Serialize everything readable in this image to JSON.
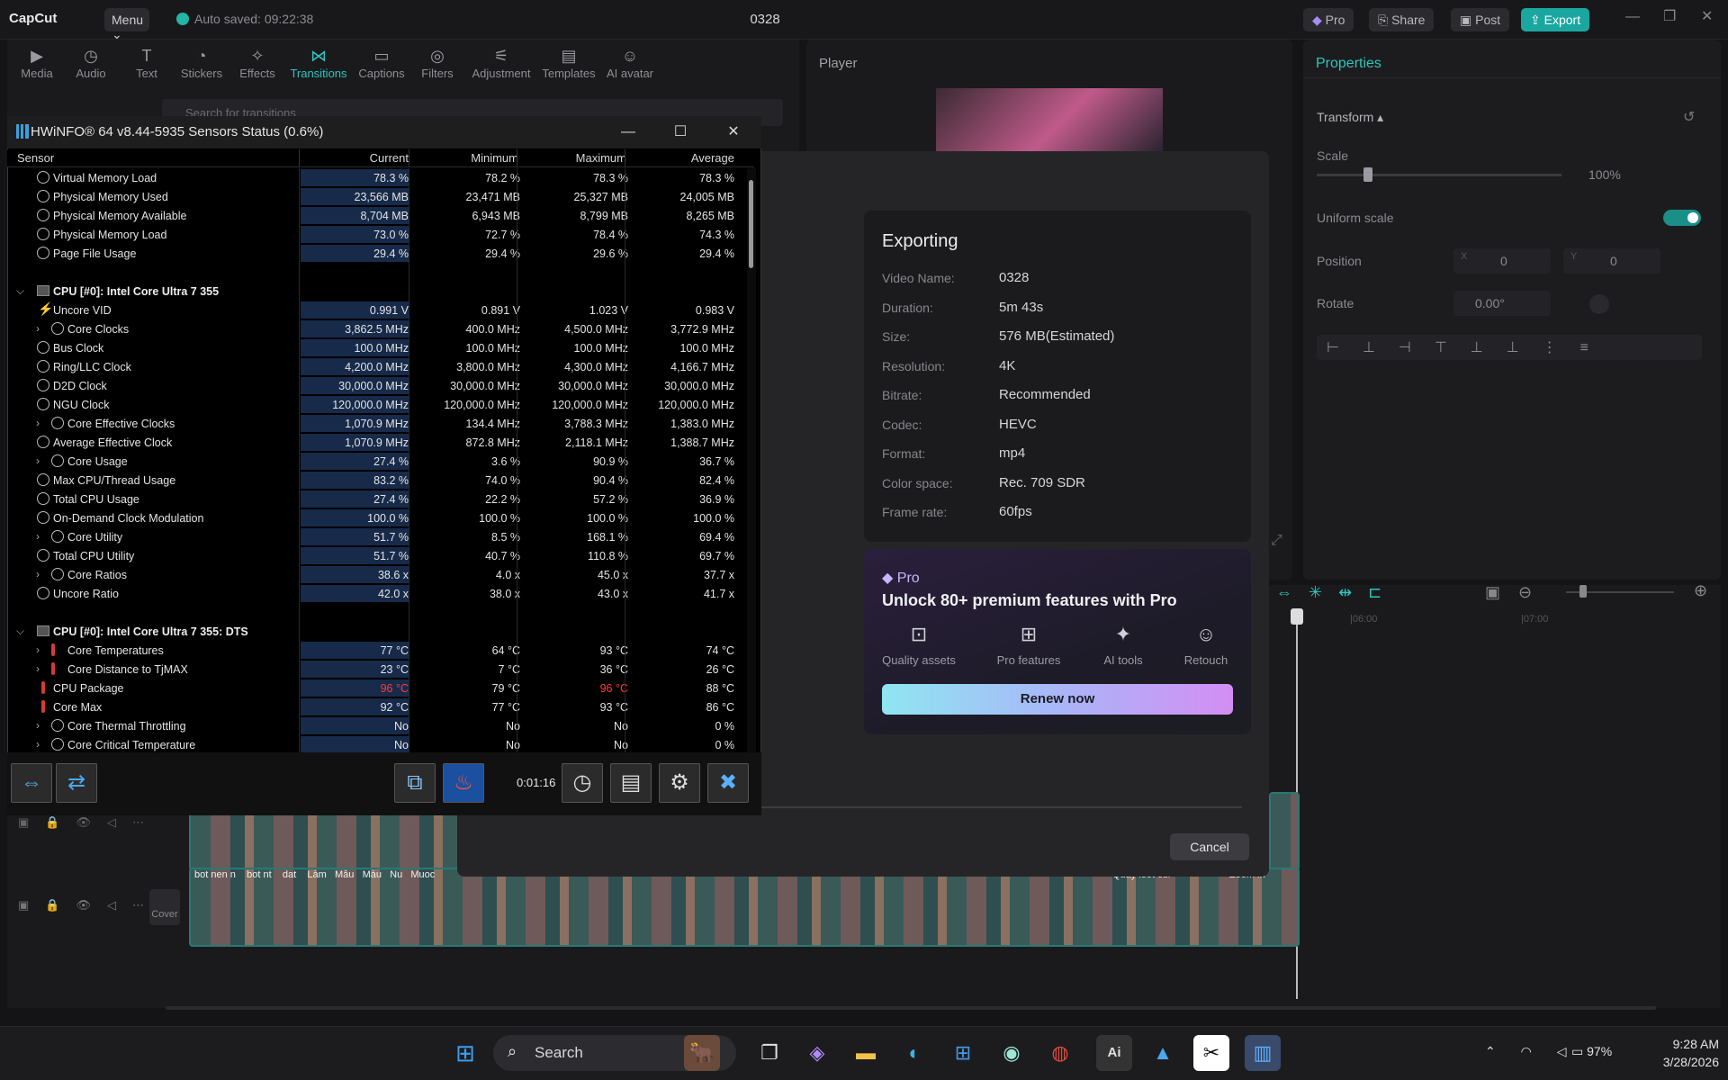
{
  "capcut": {
    "logo": "CapCut",
    "menu": "Menu ⌄",
    "autosave": "Auto saved: 09:22:38",
    "project": "0328",
    "pro_btn": "Pro",
    "share_btn": "Share",
    "post_btn": "Post",
    "export_btn": "Export",
    "tools": [
      "Media",
      "Audio",
      "Text",
      "Stickers",
      "Effects",
      "Transitions",
      "Captions",
      "Filters",
      "Adjustment",
      "Templates",
      "AI avatar"
    ],
    "active_tool": "Transitions",
    "search_placeholder": "Search for transitions",
    "player_title": "Player",
    "properties_title": "Properties",
    "transform_label": "Transform ▴",
    "scale_label": "Scale",
    "scale_value": "100%",
    "uniform_scale": "Uniform scale",
    "position_label": "Position",
    "pos_x_label": "X",
    "pos_x": "0",
    "pos_y_label": "Y",
    "pos_y": "0",
    "rotate_label": "Rotate",
    "rotate_value": "0.00°",
    "ruler_marks": [
      "|06:00",
      "|07:00"
    ],
    "track_cover": "Cover",
    "clip_captions": [
      "bot nen n",
      "bot nt",
      "dat",
      "Làm",
      "Mẫu",
      "Màu",
      "Nu",
      "Muoc",
      "Quay loot cur",
      "Zoom in"
    ]
  },
  "export": {
    "title": "Exporting",
    "fields": [
      {
        "label": "Video Name:",
        "value": "0328"
      },
      {
        "label": "Duration:",
        "value": "5m 43s"
      },
      {
        "label": "Size:",
        "value": "576 MB(Estimated)"
      },
      {
        "label": "Resolution:",
        "value": "4K"
      },
      {
        "label": "Bitrate:",
        "value": "Recommended"
      },
      {
        "label": "Codec:",
        "value": "HEVC"
      },
      {
        "label": "Format:",
        "value": "mp4"
      },
      {
        "label": "Color space:",
        "value": "Rec. 709 SDR"
      },
      {
        "label": "Frame rate:",
        "value": "60fps"
      }
    ],
    "pro_label": "Pro",
    "pro_title": "Unlock 80+ premium features with Pro",
    "features": [
      "Quality assets",
      "Pro features",
      "AI tools",
      "Retouch"
    ],
    "renew": "Renew now",
    "cancel": "Cancel"
  },
  "hwinfo": {
    "title": "HWiNFO® 64 v8.44-5935 Sensors Status (0.6%)",
    "columns": [
      "Sensor",
      "Current",
      "Minimum",
      "Maximum",
      "Average"
    ],
    "rows": [
      {
        "name": "Virtual Memory Load",
        "cur": "78.3 %",
        "min": "78.2 %",
        "max": "78.3 %",
        "avg": "78.3 %"
      },
      {
        "name": "Physical Memory Used",
        "cur": "23,566 MB",
        "min": "23,471 MB",
        "max": "25,327 MB",
        "avg": "24,005 MB"
      },
      {
        "name": "Physical Memory Available",
        "cur": "8,704 MB",
        "min": "6,943 MB",
        "max": "8,799 MB",
        "avg": "8,265 MB"
      },
      {
        "name": "Physical Memory Load",
        "cur": "73.0 %",
        "min": "72.7 %",
        "max": "78.4 %",
        "avg": "74.3 %"
      },
      {
        "name": "Page File Usage",
        "cur": "29.4 %",
        "min": "29.4 %",
        "max": "29.6 %",
        "avg": "29.4 %"
      },
      {
        "name": "",
        "cur": "",
        "min": "",
        "max": "",
        "avg": ""
      },
      {
        "name": "CPU [#0]: Intel Core Ultra 7 355",
        "group": true
      },
      {
        "name": "Uncore VID",
        "cur": "0.991 V",
        "min": "0.891 V",
        "max": "1.023 V",
        "avg": "0.983 V",
        "icon": "bolt"
      },
      {
        "name": "Core Clocks",
        "cur": "3,862.5 MHz",
        "min": "400.0 MHz",
        "max": "4,500.0 MHz",
        "avg": "3,772.9 MHz",
        "expand": true
      },
      {
        "name": "Bus Clock",
        "cur": "100.0 MHz",
        "min": "100.0 MHz",
        "max": "100.0 MHz",
        "avg": "100.0 MHz"
      },
      {
        "name": "Ring/LLC Clock",
        "cur": "4,200.0 MHz",
        "min": "3,800.0 MHz",
        "max": "4,300.0 MHz",
        "avg": "4,166.7 MHz"
      },
      {
        "name": "D2D Clock",
        "cur": "30,000.0 MHz",
        "min": "30,000.0 MHz",
        "max": "30,000.0 MHz",
        "avg": "30,000.0 MHz"
      },
      {
        "name": "NGU Clock",
        "cur": "120,000.0 MHz",
        "min": "120,000.0 MHz",
        "max": "120,000.0 MHz",
        "avg": "120,000.0 MHz"
      },
      {
        "name": "Core Effective Clocks",
        "cur": "1,070.9 MHz",
        "min": "134.4 MHz",
        "max": "3,788.3 MHz",
        "avg": "1,383.0 MHz",
        "expand": true
      },
      {
        "name": "Average Effective Clock",
        "cur": "1,070.9 MHz",
        "min": "872.8 MHz",
        "max": "2,118.1 MHz",
        "avg": "1,388.7 MHz"
      },
      {
        "name": "Core Usage",
        "cur": "27.4 %",
        "min": "3.6 %",
        "max": "90.9 %",
        "avg": "36.7 %",
        "expand": true
      },
      {
        "name": "Max CPU/Thread Usage",
        "cur": "83.2 %",
        "min": "74.0 %",
        "max": "90.4 %",
        "avg": "82.4 %"
      },
      {
        "name": "Total CPU Usage",
        "cur": "27.4 %",
        "min": "22.2 %",
        "max": "57.2 %",
        "avg": "36.9 %"
      },
      {
        "name": "On-Demand Clock Modulation",
        "cur": "100.0 %",
        "min": "100.0 %",
        "max": "100.0 %",
        "avg": "100.0 %"
      },
      {
        "name": "Core Utility",
        "cur": "51.7 %",
        "min": "8.5 %",
        "max": "168.1 %",
        "avg": "69.4 %",
        "expand": true
      },
      {
        "name": "Total CPU Utility",
        "cur": "51.7 %",
        "min": "40.7 %",
        "max": "110.8 %",
        "avg": "69.7 %"
      },
      {
        "name": "Core Ratios",
        "cur": "38.6 x",
        "min": "4.0 x",
        "max": "45.0 x",
        "avg": "37.7 x",
        "expand": true
      },
      {
        "name": "Uncore Ratio",
        "cur": "42.0 x",
        "min": "38.0 x",
        "max": "43.0 x",
        "avg": "41.7 x"
      },
      {
        "name": "",
        "cur": "",
        "min": "",
        "max": "",
        "avg": ""
      },
      {
        "name": "CPU [#0]: Intel Core Ultra 7 355: DTS",
        "group": true
      },
      {
        "name": "Core Temperatures",
        "cur": "77 °C",
        "min": "64 °C",
        "max": "93 °C",
        "avg": "74 °C",
        "expand": true,
        "icon": "therm"
      },
      {
        "name": "Core Distance to TjMAX",
        "cur": "23 °C",
        "min": "7 °C",
        "max": "36 °C",
        "avg": "26 °C",
        "expand": true,
        "icon": "therm"
      },
      {
        "name": "CPU Package",
        "cur": "96 °C",
        "min": "79 °C",
        "max": "96 °C",
        "avg": "88 °C",
        "icon": "therm",
        "curRed": true,
        "maxRed": true
      },
      {
        "name": "Core Max",
        "cur": "92 °C",
        "min": "77 °C",
        "max": "93 °C",
        "avg": "86 °C",
        "icon": "therm"
      },
      {
        "name": "Core Thermal Throttling",
        "cur": "No",
        "min": "No",
        "max": "No",
        "avg": "0 %",
        "expand": true
      },
      {
        "name": "Core Critical Temperature",
        "cur": "No",
        "min": "No",
        "max": "No",
        "avg": "0 %",
        "expand": true
      }
    ],
    "elapsed": "0:01:16"
  },
  "taskbar": {
    "search": "Search",
    "battery": "97%",
    "time": "9:28 AM",
    "date": "3/28/2026"
  }
}
